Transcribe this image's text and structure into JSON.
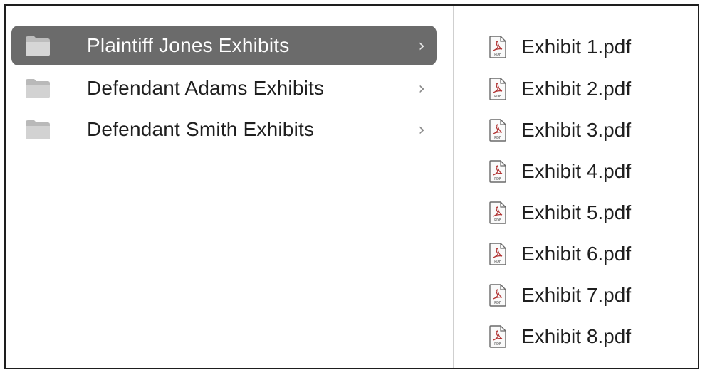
{
  "folders": [
    {
      "label": "Plaintiff Jones Exhibits",
      "selected": true,
      "icon": "folder-icon",
      "chevron": "›"
    },
    {
      "label": "Defendant Adams Exhibits",
      "selected": false,
      "icon": "folder-icon",
      "chevron": "›"
    },
    {
      "label": "Defendant Smith Exhibits",
      "selected": false,
      "icon": "folder-icon",
      "chevron": "›"
    }
  ],
  "files": [
    {
      "label": "Exhibit 1.pdf",
      "icon": "pdf-file-icon"
    },
    {
      "label": "Exhibit 2.pdf",
      "icon": "pdf-file-icon"
    },
    {
      "label": "Exhibit 3.pdf",
      "icon": "pdf-file-icon"
    },
    {
      "label": "Exhibit 4.pdf",
      "icon": "pdf-file-icon"
    },
    {
      "label": "Exhibit 5.pdf",
      "icon": "pdf-file-icon"
    },
    {
      "label": "Exhibit 6.pdf",
      "icon": "pdf-file-icon"
    },
    {
      "label": "Exhibit 7.pdf",
      "icon": "pdf-file-icon"
    },
    {
      "label": "Exhibit 8.pdf",
      "icon": "pdf-file-icon"
    }
  ],
  "colors": {
    "selection": "#6b6b6b",
    "text": "#1f1f1f",
    "selected_text": "#ffffff",
    "folder": "#c9c9c9"
  }
}
